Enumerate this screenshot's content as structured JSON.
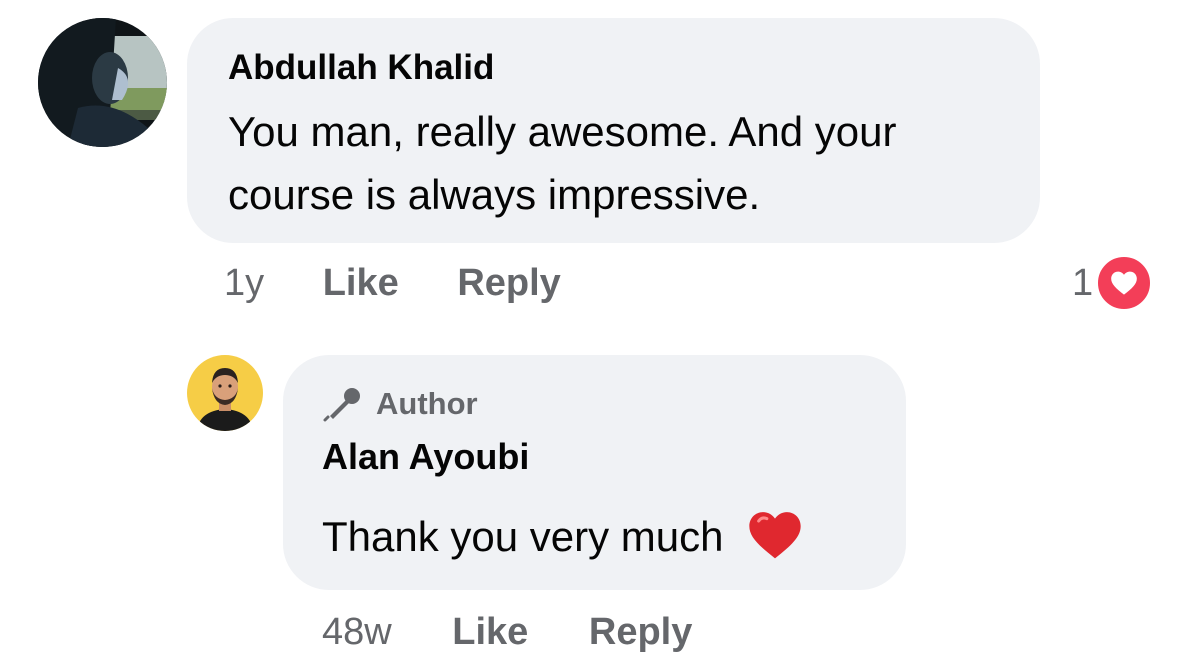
{
  "comment": {
    "author_name": "Abdullah Khalid",
    "text": "You man, really awesome. And your course is always impressive.",
    "time": "1y",
    "like_label": "Like",
    "reply_label": "Reply",
    "reaction_count": "1",
    "reaction_icon": "heart-icon"
  },
  "reply": {
    "badge_label": "Author",
    "badge_icon": "microphone-icon",
    "author_name": "Alan Ayoubi",
    "text": "Thank you very much",
    "emoji": "❤️",
    "time": "48w",
    "like_label": "Like",
    "reply_label": "Reply"
  },
  "colors": {
    "bubble": "#f0f2f5",
    "meta_text": "#65676b",
    "heart": "#f33e58"
  }
}
